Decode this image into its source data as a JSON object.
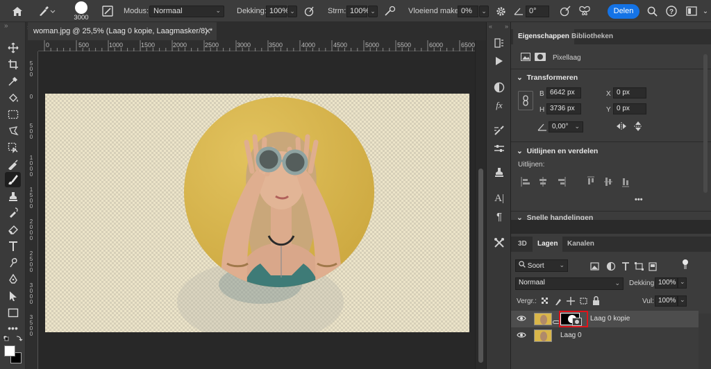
{
  "options_bar": {
    "brush_size": "3000",
    "mode_label": "Modus:",
    "mode_value": "Normaal",
    "opacity_label": "Dekking:",
    "opacity_value": "100%",
    "flow_label": "Strm:",
    "flow_value": "100%",
    "smoothing_label": "Vloeiend maken:",
    "smoothing_value": "0%",
    "angle_value": "0°",
    "share_label": "Delen"
  },
  "document": {
    "tab_title": "woman.jpg @ 25,5% (Laag 0 kopie, Laagmasker/8) *",
    "ruler_h": [
      "0",
      "500",
      "1000",
      "1500",
      "2000",
      "2500",
      "3000",
      "3500",
      "4000",
      "4500",
      "5000",
      "5500",
      "6000",
      "6500"
    ],
    "ruler_v": [
      "5 0 0",
      "0",
      "5 0 0",
      "1 0 0 0",
      "1 5 0 0",
      "2 0 0 0",
      "2 5 0 0",
      "3 0 0 0",
      "3 5 0 0"
    ]
  },
  "properties": {
    "tab_properties": "Eigenschappen",
    "tab_libraries": "Bibliotheken",
    "layer_type": "Pixellaag",
    "transform_title": "Transformeren",
    "w_label": "B",
    "w_value": "6642 px",
    "h_label": "H",
    "h_value": "3736 px",
    "x_label": "X",
    "x_value": "0 px",
    "y_label": "Y",
    "y_value": "0 px",
    "angle_value": "0,00°",
    "align_title": "Uitlijnen en verdelen",
    "align_label": "Uitlijnen:",
    "more": "•••",
    "quick_actions_title": "Snelle handelingen"
  },
  "layers_panel": {
    "tab_3d": "3D",
    "tab_layers": "Lagen",
    "tab_channels": "Kanalen",
    "filter_label": "Soort",
    "blend_mode": "Normaal",
    "opacity_label": "Dekking:",
    "opacity_value": "100%",
    "lock_label": "Vergr.:",
    "fill_label": "Vul:",
    "fill_value": "100%",
    "layers": [
      {
        "name": "Laag 0 kopie",
        "has_mask": true,
        "selected": true
      },
      {
        "name": "Laag 0",
        "has_mask": false,
        "selected": false
      }
    ]
  },
  "colors": {
    "accent": "#1473e6",
    "highlight_red": "#e0141b",
    "canvas_yellow": "#d9b64a",
    "panel_bg": "#3c3c3c"
  }
}
